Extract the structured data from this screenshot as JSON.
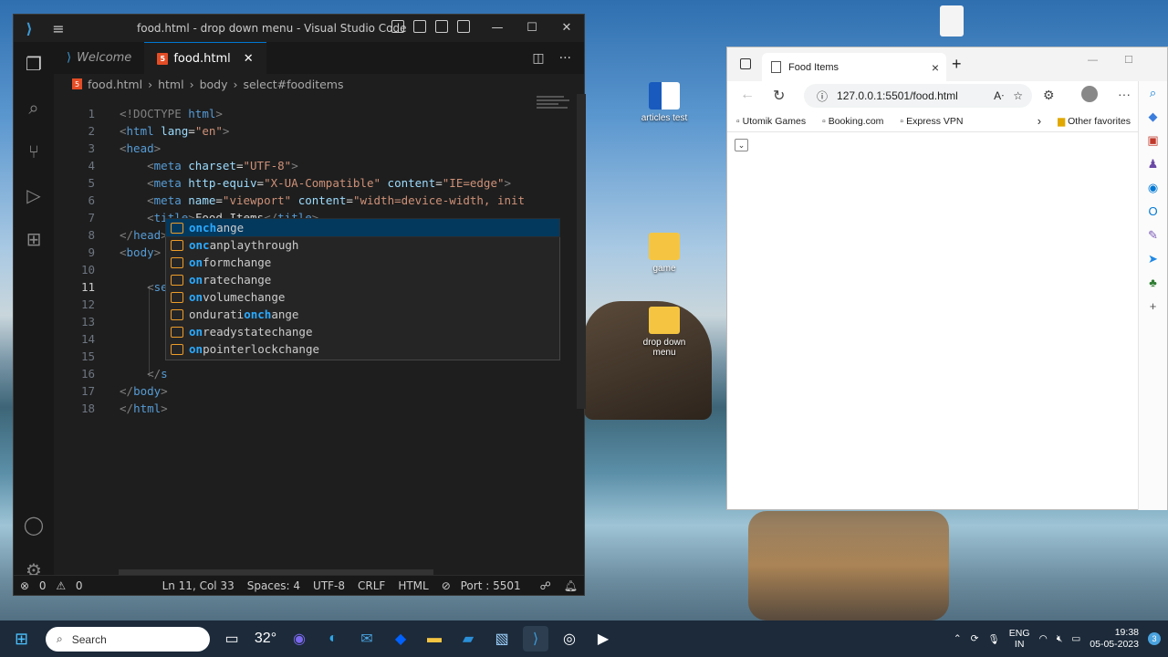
{
  "vscode": {
    "window_title": "food.html - drop down menu - Visual Studio Code",
    "tabs": [
      {
        "label": "Welcome"
      },
      {
        "label": "food.html"
      }
    ],
    "breadcrumb": [
      "food.html",
      "html",
      "body",
      "select#fooditems"
    ],
    "lines": [
      {
        "n": "1",
        "parts": [
          [
            "tag",
            "<!DOCTYPE "
          ],
          [
            "tn",
            "html"
          ],
          [
            "tag",
            ">"
          ]
        ]
      },
      {
        "n": "2",
        "parts": [
          [
            "tag",
            "<"
          ],
          [
            "tn",
            "html"
          ],
          [
            "an",
            " lang"
          ],
          [
            "tx",
            "="
          ],
          [
            "av",
            "\"en\""
          ],
          [
            "tag",
            ">"
          ]
        ]
      },
      {
        "n": "3",
        "parts": [
          [
            "tag",
            "<"
          ],
          [
            "tn",
            "head"
          ],
          [
            "tag",
            ">"
          ]
        ]
      },
      {
        "n": "4",
        "parts": [
          [
            "tx",
            "    "
          ],
          [
            "tag",
            "<"
          ],
          [
            "tn",
            "meta"
          ],
          [
            "an",
            " charset"
          ],
          [
            "tx",
            "="
          ],
          [
            "av",
            "\"UTF-8\""
          ],
          [
            "tag",
            ">"
          ]
        ]
      },
      {
        "n": "5",
        "parts": [
          [
            "tx",
            "    "
          ],
          [
            "tag",
            "<"
          ],
          [
            "tn",
            "meta"
          ],
          [
            "an",
            " http-equiv"
          ],
          [
            "tx",
            "="
          ],
          [
            "av",
            "\"X-UA-Compatible\""
          ],
          [
            "an",
            " content"
          ],
          [
            "tx",
            "="
          ],
          [
            "av",
            "\"IE=edge\""
          ],
          [
            "tag",
            ">"
          ]
        ]
      },
      {
        "n": "6",
        "parts": [
          [
            "tx",
            "    "
          ],
          [
            "tag",
            "<"
          ],
          [
            "tn",
            "meta"
          ],
          [
            "an",
            " name"
          ],
          [
            "tx",
            "="
          ],
          [
            "av",
            "\"viewport\""
          ],
          [
            "an",
            " content"
          ],
          [
            "tx",
            "="
          ],
          [
            "av",
            "\"width=device-width, init"
          ]
        ]
      },
      {
        "n": "7",
        "parts": [
          [
            "tx",
            "    "
          ],
          [
            "tag",
            "<"
          ],
          [
            "tn",
            "title"
          ],
          [
            "tag",
            ">"
          ],
          [
            "tx",
            "Food Items"
          ],
          [
            "tag",
            "</"
          ],
          [
            "tn",
            "title"
          ],
          [
            "tag",
            ">"
          ]
        ]
      },
      {
        "n": "8",
        "parts": [
          [
            "tag",
            "</"
          ],
          [
            "tn",
            "head"
          ],
          [
            "tag",
            ">"
          ]
        ]
      },
      {
        "n": "9",
        "parts": [
          [
            "tag",
            "<"
          ],
          [
            "tn",
            "body"
          ],
          [
            "tag",
            ">"
          ]
        ]
      },
      {
        "n": "10",
        "parts": []
      },
      {
        "n": "11",
        "parts": [
          [
            "tx",
            "    "
          ],
          [
            "tag",
            "<"
          ],
          [
            "tn",
            "select"
          ],
          [
            "an",
            "  id"
          ],
          [
            "tx",
            "="
          ],
          [
            "av",
            "\"fooditems\""
          ],
          [
            "tx",
            " onch"
          ],
          [
            "tag",
            ">"
          ]
        ]
      },
      {
        "n": "12",
        "parts": []
      },
      {
        "n": "13",
        "parts": []
      },
      {
        "n": "14",
        "parts": []
      },
      {
        "n": "15",
        "parts": []
      },
      {
        "n": "16",
        "parts": [
          [
            "tx",
            "    "
          ],
          [
            "tag",
            "</"
          ],
          [
            "tn",
            "s"
          ]
        ]
      },
      {
        "n": "17",
        "parts": [
          [
            "tag",
            "</"
          ],
          [
            "tn",
            "body"
          ],
          [
            "tag",
            ">"
          ]
        ]
      },
      {
        "n": "18",
        "parts": [
          [
            "tag",
            "</"
          ],
          [
            "tn",
            "html"
          ],
          [
            "tag",
            ">"
          ]
        ]
      }
    ],
    "suggestions": [
      {
        "pre": "",
        "hl": "onch",
        "post": "ange"
      },
      {
        "pre": "",
        "hl": "onc",
        "post": "anplaythrough"
      },
      {
        "pre": "",
        "hl": "on",
        "post": "formchange"
      },
      {
        "pre": "",
        "hl": "on",
        "post": "ratechange"
      },
      {
        "pre": "",
        "hl": "on",
        "post": "volumechange"
      },
      {
        "pre": "ondurati",
        "hl": "onch",
        "post": "ange"
      },
      {
        "pre": "",
        "hl": "on",
        "post": "readystatechange"
      },
      {
        "pre": "",
        "hl": "on",
        "post": "pointerlockchange"
      }
    ],
    "status": {
      "errors": "0",
      "warnings": "0",
      "position": "Ln 11, Col 33",
      "spaces": "Spaces: 4",
      "encoding": "UTF-8",
      "eol": "CRLF",
      "language": "HTML",
      "port": "Port : 5501"
    }
  },
  "browser": {
    "tab_title": "Food Items",
    "url": "127.0.0.1:5501/food.html",
    "favorites": [
      "Utomik Games",
      "Booking.com",
      "Express VPN"
    ],
    "other_favorites": "Other favorites"
  },
  "desktop": {
    "icons": [
      "articles test",
      "game",
      "drop down menu"
    ]
  },
  "taskbar": {
    "search_placeholder": "Search",
    "weather": "32°",
    "lang1": "ENG",
    "lang2": "IN",
    "time": "19:38",
    "date": "05-05-2023",
    "notif_count": "3"
  }
}
